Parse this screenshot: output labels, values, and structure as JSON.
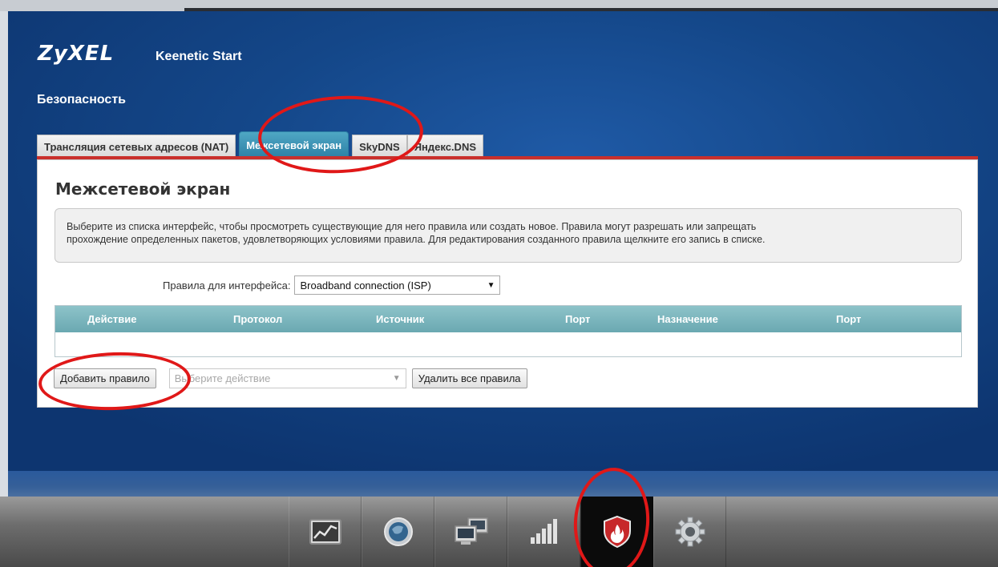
{
  "header": {
    "brand": "ZyXEL",
    "product": "Keenetic Start",
    "section": "Безопасность"
  },
  "tabs": [
    {
      "label": "Трансляция сетевых адресов (NAT)",
      "active": false
    },
    {
      "label": "Межсетевой экран",
      "active": true
    },
    {
      "label": "SkyDNS",
      "active": false
    },
    {
      "label": "Яндекс.DNS",
      "active": false
    }
  ],
  "panel": {
    "title": "Межсетевой экран",
    "info_line1": "Выберите из списка интерфейс, чтобы просмотреть существующие для него правила или создать новое. Правила могут разрешать или запрещать",
    "info_line2": "прохождение определенных пакетов, удовлетворяющих условиями правила. Для редактирования созданного правила щелкните его запись в списке.",
    "iface_label": "Правила для интерфейса:",
    "iface_value": "Broadband connection (ISP)"
  },
  "table": {
    "columns": [
      "Действие",
      "Протокол",
      "Источник",
      "Порт",
      "Назначение",
      "Порт"
    ],
    "rows": []
  },
  "actions": {
    "add_rule": "Добавить правило",
    "action_placeholder": "Выберите действие",
    "delete_all": "Удалить все правила"
  },
  "bottom_nav": [
    {
      "icon": "monitor-chart-icon",
      "active": false
    },
    {
      "icon": "globe-icon",
      "active": false
    },
    {
      "icon": "network-computers-icon",
      "active": false
    },
    {
      "icon": "signal-bars-icon",
      "active": false
    },
    {
      "icon": "firewall-shield-icon",
      "active": true
    },
    {
      "icon": "gear-icon",
      "active": false
    }
  ],
  "colors": {
    "accent_red": "#c9302c",
    "tab_active": "#2b7fa4",
    "table_header": "#6aa8b1",
    "annotation": "#e01818"
  }
}
